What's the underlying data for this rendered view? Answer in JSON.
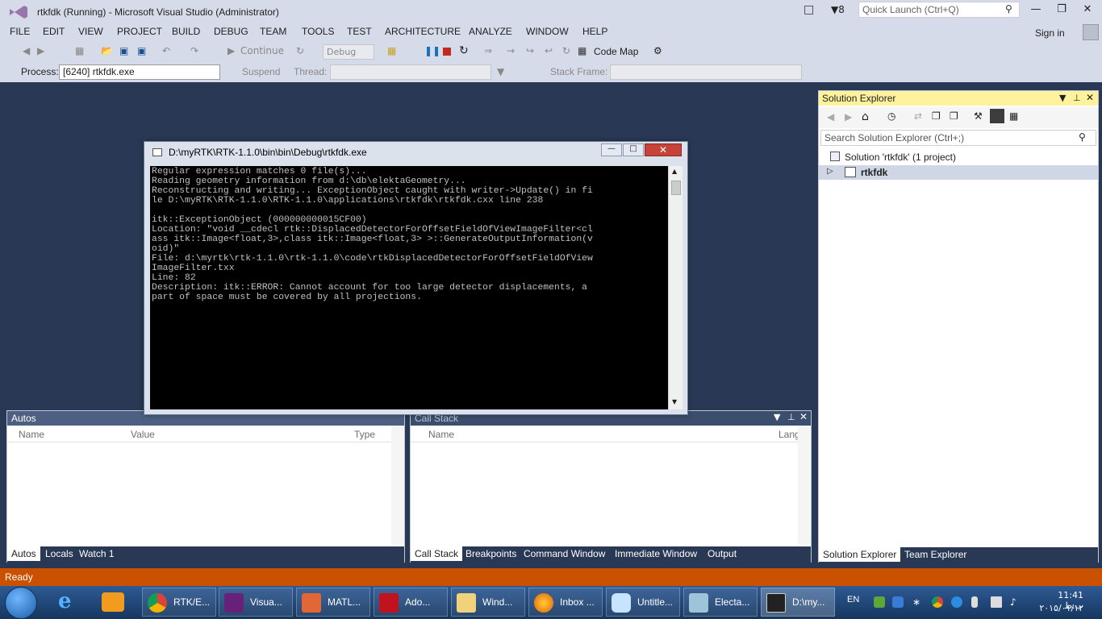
{
  "window": {
    "title": "rtkfdk (Running) - Microsoft Visual Studio (Administrator)",
    "notification_count": "8",
    "quick_launch_placeholder": "Quick Launch (Ctrl+Q)",
    "sign_in": "Sign in"
  },
  "menu": [
    "FILE",
    "EDIT",
    "VIEW",
    "PROJECT",
    "BUILD",
    "DEBUG",
    "TEAM",
    "TOOLS",
    "TEST",
    "ARCHITECTURE",
    "ANALYZE",
    "WINDOW",
    "HELP"
  ],
  "toolbar": {
    "continue_label": "Continue",
    "config_value": "Debug",
    "code_map_label": "Code Map"
  },
  "debug_location": {
    "process_label": "Process:",
    "process_value": "[6240] rtkfdk.exe",
    "suspend_label": "Suspend",
    "thread_label": "Thread:",
    "stack_frame_label": "Stack Frame:"
  },
  "console": {
    "title": "D:\\myRTK\\RTK-1.1.0\\bin\\bin\\Debug\\rtkfdk.exe",
    "lines": [
      "Regular expression matches 0 file(s)...",
      "Reading geometry information from d:\\db\\elektaGeometry...",
      "Reconstructing and writing... ExceptionObject caught with writer->Update() in fi",
      "le D:\\myRTK\\RTK-1.1.0\\RTK-1.1.0\\applications\\rtkfdk\\rtkfdk.cxx line 238",
      "",
      "itk::ExceptionObject (000000000015CF00)",
      "Location: \"void __cdecl rtk::DisplacedDetectorForOffsetFieldOfViewImageFilter<cl",
      "ass itk::Image<float,3>,class itk::Image<float,3> >::GenerateOutputInformation(v",
      "oid)\"",
      "File: d:\\myrtk\\rtk-1.1.0\\rtk-1.1.0\\code\\rtkDisplacedDetectorForOffsetFieldOfView",
      "ImageFilter.txx",
      "Line: 82",
      "Description: itk::ERROR: Cannot account for too large detector displacements, a",
      "part of space must be covered by all projections."
    ]
  },
  "solution_explorer": {
    "title": "Solution Explorer",
    "search_placeholder": "Search Solution Explorer (Ctrl+;)",
    "root": "Solution 'rtkfdk' (1 project)",
    "project": "rtkfdk",
    "tabs": [
      "Solution Explorer",
      "Team Explorer"
    ]
  },
  "autos": {
    "title": "Autos",
    "columns": [
      "Name",
      "Value",
      "Type"
    ],
    "tabs": [
      "Autos",
      "Locals",
      "Watch 1"
    ]
  },
  "call_stack": {
    "title": "Call Stack",
    "columns": [
      "Name",
      "Lang"
    ],
    "tabs": [
      "Call Stack",
      "Breakpoints",
      "Command Window",
      "Immediate Window",
      "Output"
    ]
  },
  "status": "Ready",
  "taskbar": {
    "items": [
      "RTK/E...",
      "Visua...",
      "MATL...",
      "Ado...",
      "Wind...",
      "Inbox ...",
      "Untitle...",
      "Electa...",
      "D:\\my..."
    ],
    "language": "EN",
    "time": "11:41 ب.ظ",
    "date": "۲۰۱۵/۰۱/۱۲"
  }
}
